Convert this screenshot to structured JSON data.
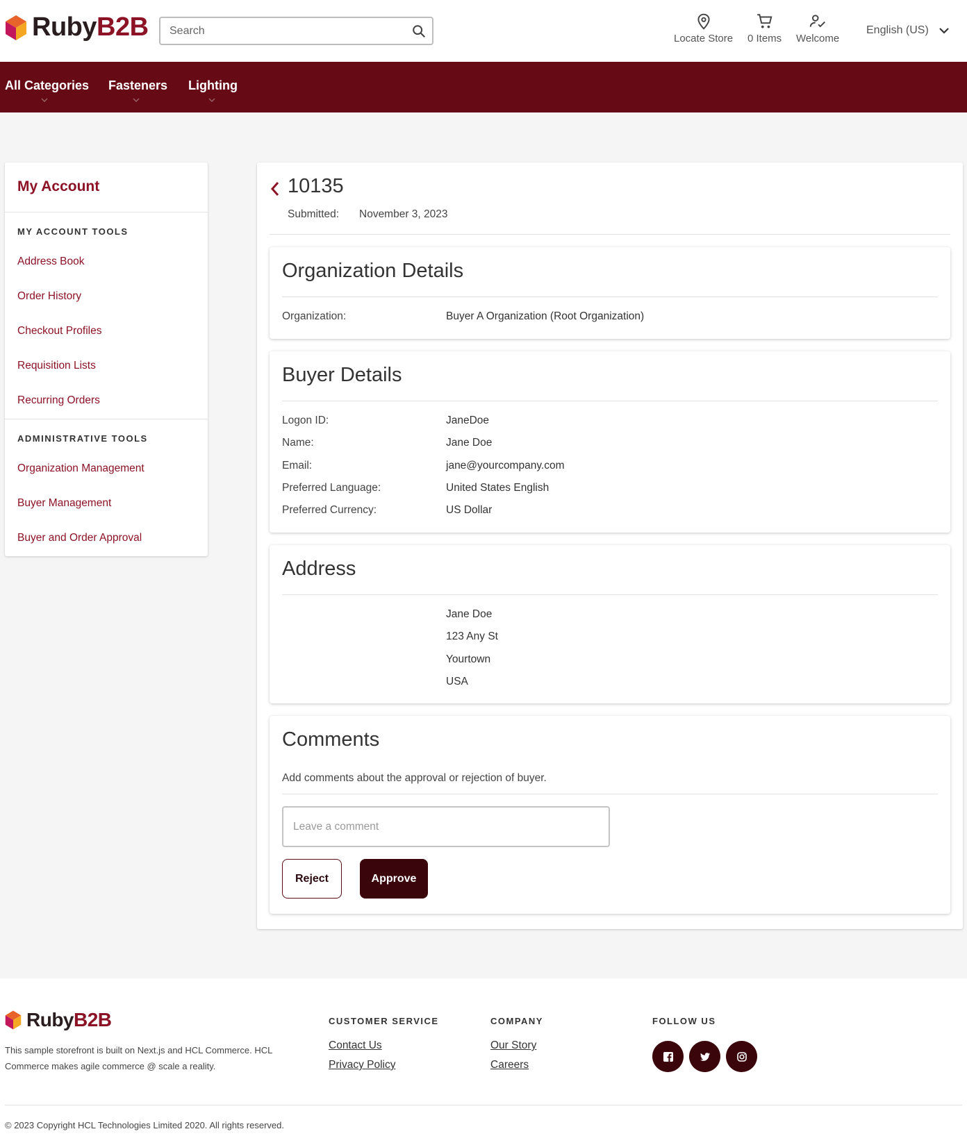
{
  "brand": {
    "name_part1": "Ruby",
    "name_part2": "B2B"
  },
  "header": {
    "search_placeholder": "Search",
    "actions": {
      "locate": "Locate Store",
      "cart": "0 Items",
      "welcome": "Welcome"
    },
    "language": "English (US)"
  },
  "nav": {
    "items": [
      "All Categories",
      "Fasteners",
      "Lighting"
    ]
  },
  "sidebar": {
    "title": "My Account",
    "section1": "MY ACCOUNT TOOLS",
    "links1": [
      "Address Book",
      "Order History",
      "Checkout Profiles",
      "Requisition Lists",
      "Recurring Orders"
    ],
    "section2": "ADMINISTRATIVE TOOLS",
    "links2": [
      "Organization Management",
      "Buyer Management",
      "Buyer and Order Approval"
    ]
  },
  "request": {
    "id": "10135",
    "submitted_label": "Submitted:",
    "submitted_value": "November 3, 2023"
  },
  "org_card": {
    "title": "Organization Details",
    "label": "Organization:",
    "value": "Buyer A Organization (Root Organization)"
  },
  "buyer_card": {
    "title": "Buyer Details",
    "rows": [
      {
        "label": "Logon ID:",
        "value": "JaneDoe"
      },
      {
        "label": "Name:",
        "value": "Jane Doe"
      },
      {
        "label": "Email:",
        "value": "jane@yourcompany.com"
      },
      {
        "label": "Preferred Language:",
        "value": "United States English"
      },
      {
        "label": "Preferred Currency:",
        "value": "US Dollar"
      }
    ]
  },
  "address_card": {
    "title": "Address",
    "lines": [
      "Jane Doe",
      "123 Any St",
      "Yourtown",
      "USA"
    ]
  },
  "comments_card": {
    "title": "Comments",
    "description": "Add comments about the approval or rejection of buyer.",
    "placeholder": "Leave a comment",
    "reject_label": "Reject",
    "approve_label": "Approve"
  },
  "footer": {
    "description": "This sample storefront is built on Next.js and HCL Commerce. HCL Commerce makes agile commerce @ scale a reality.",
    "customer_service": {
      "heading": "CUSTOMER SERVICE",
      "links": [
        "Contact Us",
        "Privacy Policy"
      ]
    },
    "company": {
      "heading": "COMPANY",
      "links": [
        "Our Story",
        "Careers"
      ]
    },
    "follow": {
      "heading": "FOLLOW US",
      "icons": [
        "facebook-icon",
        "twitter-icon",
        "instagram-icon"
      ]
    },
    "copyright": "© 2023 Copyright HCL Technologies Limited 2020. All rights reserved."
  },
  "colors": {
    "brand": "#8c1226",
    "nav": "#660b15",
    "primary_button": "#3a050b"
  }
}
